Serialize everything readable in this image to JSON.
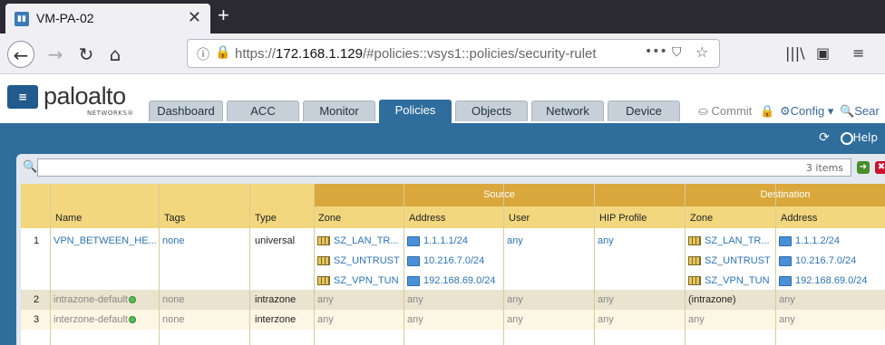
{
  "browser": {
    "tab_title": "VM-PA-02",
    "new_tab": "+",
    "close": "✕",
    "url_prefix": "https://",
    "url_host": "172.168.1.129",
    "url_path": "/#policies::vsys1::policies/security-rulet",
    "url_menu": "•••"
  },
  "app": {
    "brand": "paloalto",
    "brand_sub": "NETWORKS®",
    "tabs": [
      "Dashboard",
      "ACC",
      "Monitor",
      "Policies",
      "Objects",
      "Network",
      "Device"
    ],
    "active_tab": "Policies",
    "commit": "Commit",
    "config": "Config",
    "search": "Sear",
    "help": "Help"
  },
  "filter": {
    "items_count": "3 items"
  },
  "table": {
    "groups": {
      "source": "Source",
      "destination": "Destination"
    },
    "columns": [
      "Name",
      "Tags",
      "Type",
      "Zone",
      "Address",
      "User",
      "HIP Profile",
      "Zone",
      "Address"
    ],
    "rows": [
      {
        "num": "1",
        "name": "VPN_BETWEEN_HE...",
        "tags": "none",
        "type": "universal",
        "src_zone": [
          "SZ_LAN_TR...",
          "SZ_UNTRUST",
          "SZ_VPN_TUN"
        ],
        "src_addr": [
          "1.1.1.1/24",
          "10.216.7.0/24",
          "192.168.69.0/24"
        ],
        "user": "any",
        "hip": "any",
        "dst_zone": [
          "SZ_LAN_TR...",
          "SZ_UNTRUST",
          "SZ_VPN_TUN"
        ],
        "dst_addr": [
          "1.1.1.2/24",
          "10.216.7.0/24",
          "192.168.69.0/24"
        ]
      },
      {
        "num": "2",
        "name": "intrazone-default",
        "tags": "none",
        "type": "intrazone",
        "src_zone": "any",
        "src_addr": "any",
        "user": "any",
        "hip": "any",
        "dst_zone": "(intrazone)",
        "dst_addr": "any"
      },
      {
        "num": "3",
        "name": "interzone-default",
        "tags": "none",
        "type": "interzone",
        "src_zone": "any",
        "src_addr": "any",
        "user": "any",
        "hip": "any",
        "dst_zone": "any",
        "dst_addr": "any"
      }
    ]
  }
}
